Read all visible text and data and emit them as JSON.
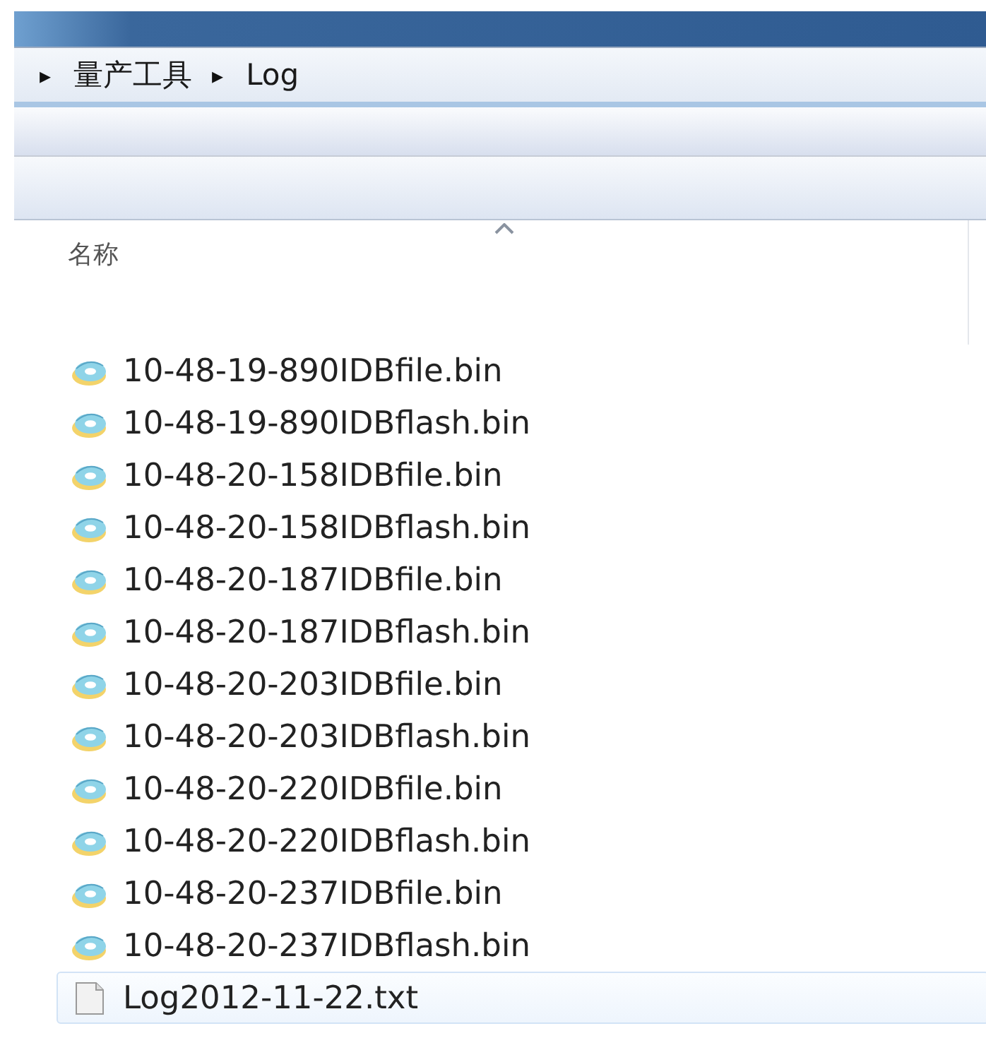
{
  "breadcrumb": [
    {
      "separator": "▸",
      "label": "量产工具"
    },
    {
      "separator": "▸",
      "label": "Log"
    }
  ],
  "column_header": {
    "label": "名称"
  },
  "files": [
    {
      "name": "10-48-19-890IDBfile.bin",
      "kind": "bin",
      "selected": false
    },
    {
      "name": "10-48-19-890IDBflash.bin",
      "kind": "bin",
      "selected": false
    },
    {
      "name": "10-48-20-158IDBfile.bin",
      "kind": "bin",
      "selected": false
    },
    {
      "name": "10-48-20-158IDBflash.bin",
      "kind": "bin",
      "selected": false
    },
    {
      "name": "10-48-20-187IDBfile.bin",
      "kind": "bin",
      "selected": false
    },
    {
      "name": "10-48-20-187IDBflash.bin",
      "kind": "bin",
      "selected": false
    },
    {
      "name": "10-48-20-203IDBfile.bin",
      "kind": "bin",
      "selected": false
    },
    {
      "name": "10-48-20-203IDBflash.bin",
      "kind": "bin",
      "selected": false
    },
    {
      "name": "10-48-20-220IDBfile.bin",
      "kind": "bin",
      "selected": false
    },
    {
      "name": "10-48-20-220IDBflash.bin",
      "kind": "bin",
      "selected": false
    },
    {
      "name": "10-48-20-237IDBfile.bin",
      "kind": "bin",
      "selected": false
    },
    {
      "name": "10-48-20-237IDBflash.bin",
      "kind": "bin",
      "selected": false
    },
    {
      "name": "Log2012-11-22.txt",
      "kind": "txt",
      "selected": true
    }
  ]
}
